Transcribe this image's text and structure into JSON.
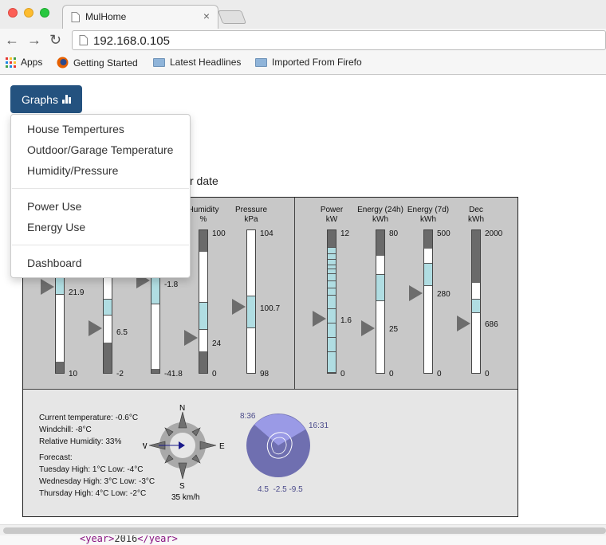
{
  "browser": {
    "tab_title": "MulHome",
    "address": "192.168.0.105",
    "bookmarks": [
      {
        "label": "Apps",
        "icon": "apps-grid-icon"
      },
      {
        "label": "Getting Started",
        "icon": "firefox-icon"
      },
      {
        "label": "Latest Headlines",
        "icon": "folder-icon"
      },
      {
        "label": "Imported From Firefo",
        "icon": "folder-icon"
      }
    ]
  },
  "nav": {
    "graphs_label": "Graphs",
    "menu": {
      "group1": [
        "House Tempertures",
        "Outdoor/Garage Temperature",
        "Humidity/Pressure"
      ],
      "group2": [
        "Power Use",
        "Energy Use"
      ],
      "group3": [
        "Dashboard"
      ]
    }
  },
  "partial_text": "r date",
  "gauges": [
    {
      "id": "t1",
      "label": "",
      "unit": "",
      "ticks": [
        "21.9",
        "10"
      ],
      "level": 0.45
    },
    {
      "id": "t2",
      "label": "",
      "unit": "",
      "ticks": [
        "6.5",
        "-2"
      ],
      "level": 0.31
    },
    {
      "id": "t3",
      "label": "",
      "unit": "",
      "ticks": [
        "-1.8",
        "-41.8"
      ],
      "level": 0.59
    },
    {
      "id": "humidity",
      "label": "Humidity",
      "unit": "%",
      "ticks": [
        "100",
        "24",
        "0"
      ],
      "level": 0.24
    },
    {
      "id": "pressure",
      "label": "Pressure",
      "unit": "kPa",
      "ticks": [
        "104",
        "100.7",
        "98"
      ],
      "level": 0.45
    },
    {
      "id": "power",
      "label": "Power",
      "unit": "kW",
      "ticks": [
        "12",
        "1.6",
        "0"
      ],
      "level": 0.36
    },
    {
      "id": "energy24",
      "label": "Energy (24h)",
      "unit": "kWh",
      "ticks": [
        "80",
        "25",
        "0"
      ],
      "level": 0.31
    },
    {
      "id": "energy7",
      "label": "Energy (7d)",
      "unit": "kWh",
      "ticks": [
        "500",
        "280",
        "0"
      ],
      "level": 0.56
    },
    {
      "id": "dec",
      "label": "Dec",
      "unit": "kWh",
      "ticks": [
        "2000",
        "686",
        "0"
      ],
      "level": 0.34
    }
  ],
  "weather": {
    "current": "Current temperature: -0.6°C",
    "windchill": "Windchill: -8°C",
    "humidity": "Relative Humidity: 33%",
    "forecast_label": "Forecast:",
    "forecast": [
      "Tuesday  High: 1°C Low: -4°C",
      "Wednesday  High: 3°C Low: -3°C",
      "Thursday  High: 4°C Low: -2°C"
    ],
    "compass": {
      "n": "N",
      "e": "E",
      "s": "S",
      "w": "W",
      "speed": "35 km/h"
    },
    "sun": {
      "sunrise": "8:36",
      "sunset": "16:31",
      "temps": "4.5  -2.5 -9.5"
    }
  },
  "editor": {
    "xml_open": "<year>",
    "xml_value": "2016",
    "xml_close": "</year>"
  },
  "colors": {
    "accent": "#24527f",
    "gauge_fill": "#b0dde2",
    "gauge_dark": "#6a6a6a",
    "sun_dark": "#6f6fb0",
    "sun_light": "#9a9ae6"
  }
}
